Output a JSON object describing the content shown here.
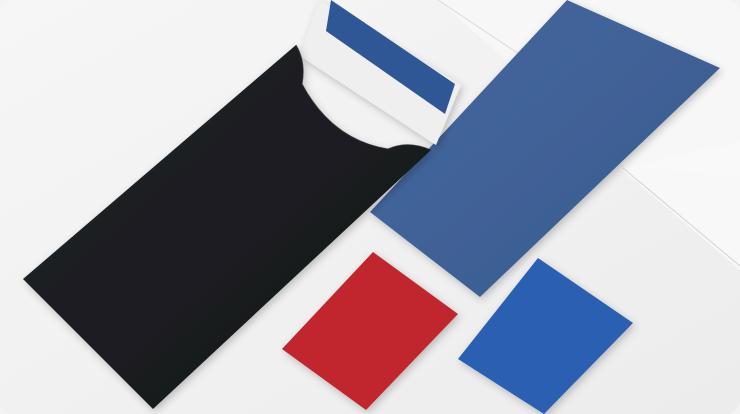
{
  "scene": {
    "description_items": [
      "black-envelope",
      "blue-letter-insert",
      "blue-large-card",
      "red-card",
      "blue-small-card"
    ],
    "colors": {
      "paper_background": "#f2f2f2",
      "paper_sheet_edge": "#e3e3e3",
      "envelope_black": "#1b1c1f",
      "envelope_shadow": "#0f1012",
      "insert_white": "#ececec",
      "insert_band_blue": "#2f5796",
      "large_card_blue": "#3f6295",
      "red_card": "#c0272d",
      "small_card_blue": "#2c5fb2"
    }
  }
}
